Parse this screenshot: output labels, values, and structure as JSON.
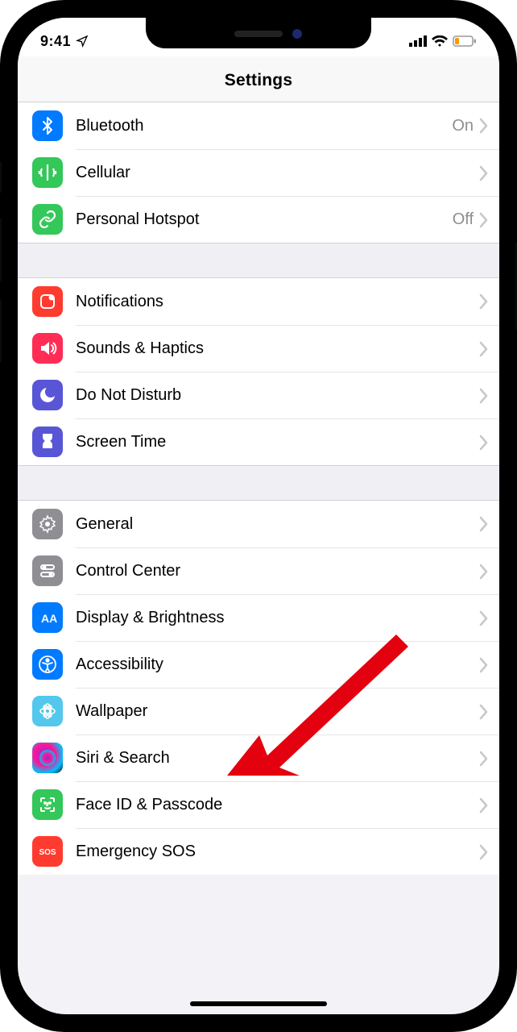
{
  "statusbar": {
    "time": "9:41"
  },
  "header": {
    "title": "Settings"
  },
  "groups": [
    {
      "rows": [
        {
          "id": "bluetooth",
          "label": "Bluetooth",
          "detail": "On",
          "icon": "bluetooth",
          "color": "#007aff"
        },
        {
          "id": "cellular",
          "label": "Cellular",
          "detail": "",
          "icon": "cellular",
          "color": "#34c759"
        },
        {
          "id": "hotspot",
          "label": "Personal Hotspot",
          "detail": "Off",
          "icon": "hotspot",
          "color": "#34c759"
        }
      ]
    },
    {
      "rows": [
        {
          "id": "notifications",
          "label": "Notifications",
          "detail": "",
          "icon": "notifications",
          "color": "#ff3b30"
        },
        {
          "id": "sounds",
          "label": "Sounds & Haptics",
          "detail": "",
          "icon": "sounds",
          "color": "#ff2d55"
        },
        {
          "id": "dnd",
          "label": "Do Not Disturb",
          "detail": "",
          "icon": "dnd",
          "color": "#5856d6"
        },
        {
          "id": "screentime",
          "label": "Screen Time",
          "detail": "",
          "icon": "screentime",
          "color": "#5856d6"
        }
      ]
    },
    {
      "rows": [
        {
          "id": "general",
          "label": "General",
          "detail": "",
          "icon": "general",
          "color": "#8e8e93"
        },
        {
          "id": "controlcenter",
          "label": "Control Center",
          "detail": "",
          "icon": "controlcenter",
          "color": "#8e8e93"
        },
        {
          "id": "display",
          "label": "Display & Brightness",
          "detail": "",
          "icon": "display",
          "color": "#007aff"
        },
        {
          "id": "accessibility",
          "label": "Accessibility",
          "detail": "",
          "icon": "accessibility",
          "color": "#007aff"
        },
        {
          "id": "wallpaper",
          "label": "Wallpaper",
          "detail": "",
          "icon": "wallpaper",
          "color": "#54c7ec"
        },
        {
          "id": "siri",
          "label": "Siri & Search",
          "detail": "",
          "icon": "siri",
          "color": "#222"
        },
        {
          "id": "faceid",
          "label": "Face ID & Passcode",
          "detail": "",
          "icon": "faceid",
          "color": "#34c759"
        },
        {
          "id": "sos",
          "label": "Emergency SOS",
          "detail": "",
          "icon": "sos",
          "color": "#ff3b30"
        }
      ]
    }
  ]
}
